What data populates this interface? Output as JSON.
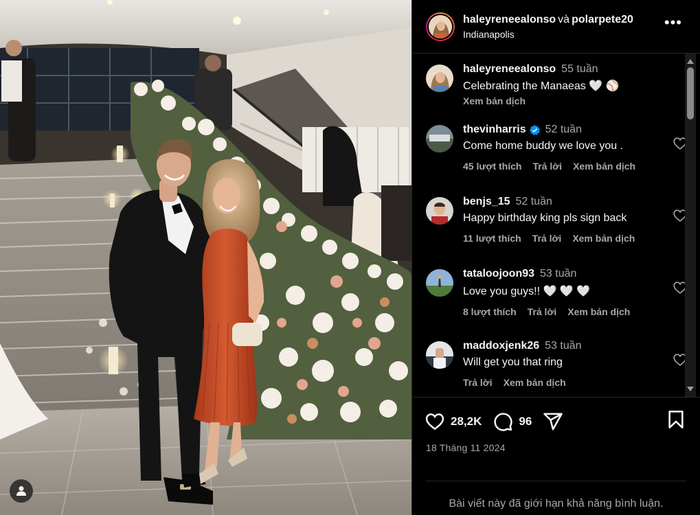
{
  "header": {
    "username_primary": "haleyreneealonso",
    "joiner": "và",
    "username_secondary": "polarpete20",
    "location": "Indianapolis",
    "more_icon": "more-horizontal-icon"
  },
  "caption": {
    "username": "haleyreneealonso",
    "time": "55 tuần",
    "text": "Celebrating the Manaeas 🤍 ⚾",
    "translate": "Xem bản dịch"
  },
  "comments": [
    {
      "username": "thevinharris",
      "verified": true,
      "time": "52 tuần",
      "text": "Come home buddy we love you .",
      "likes": "45 lượt thích",
      "reply": "Trả lời",
      "translate": "Xem bản dịch"
    },
    {
      "username": "benjs_15",
      "verified": false,
      "time": "52 tuần",
      "text": "Happy birthday king pls sign back",
      "likes": "11 lượt thích",
      "reply": "Trả lời",
      "translate": "Xem bản dịch"
    },
    {
      "username": "tataloojoon93",
      "verified": false,
      "time": "53 tuần",
      "text": "Love you guys!! 🤍 🤍 🤍",
      "likes": "8 lượt thích",
      "reply": "Trả lời",
      "translate": "Xem bản dịch"
    },
    {
      "username": "maddoxjenk26",
      "verified": false,
      "time": "53 tuần",
      "text": "Will get you that ring",
      "likes": "",
      "reply": "Trả lời",
      "translate": "Xem bản dịch"
    }
  ],
  "actions": {
    "like_count": "28,2K",
    "comment_count": "96",
    "like_icon": "heart-icon",
    "comment_icon": "comment-icon",
    "share_icon": "share-icon",
    "save_icon": "bookmark-icon"
  },
  "post_date": "18 Tháng 11 2024",
  "comments_limited": "Bài viết này đã giới hạn khả năng bình luận.",
  "colors": {
    "background": "#000000",
    "text_primary": "#f5f5f5",
    "text_secondary": "#a8a8a8",
    "divider": "#262626",
    "verified_blue": "#0095f6",
    "dress": "#c94a27"
  }
}
